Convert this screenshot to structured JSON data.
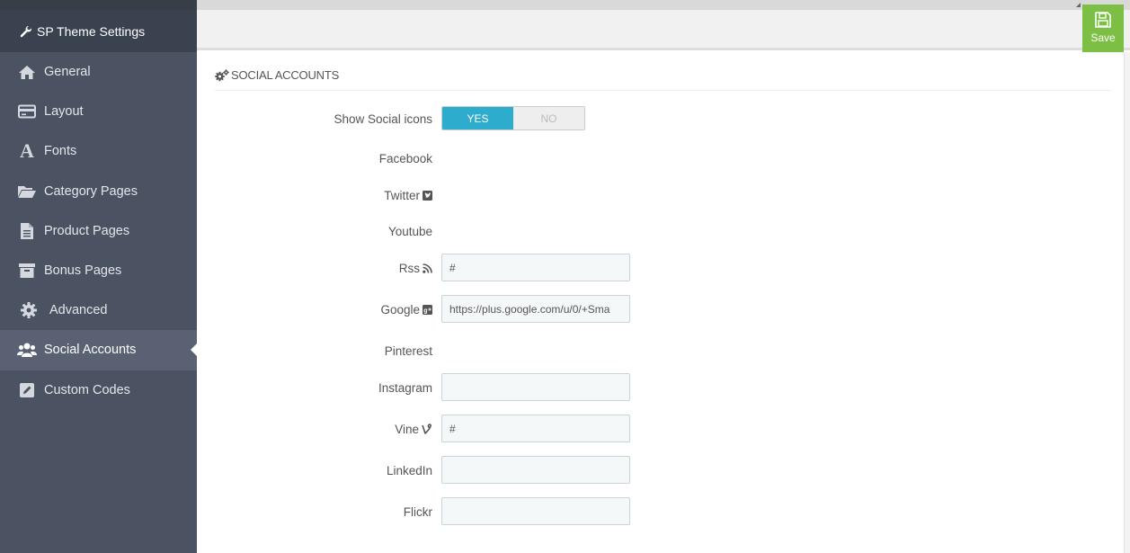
{
  "sidebar": {
    "title": "SP Theme Settings",
    "items": [
      {
        "label": "General",
        "icon": "home-icon"
      },
      {
        "label": "Layout",
        "icon": "credit-card-icon"
      },
      {
        "label": "Fonts",
        "icon": "font-icon"
      },
      {
        "label": "Category Pages",
        "icon": "folder-open-icon"
      },
      {
        "label": "Product Pages",
        "icon": "file-text-icon"
      },
      {
        "label": "Bonus Pages",
        "icon": "archive-icon"
      },
      {
        "label": "Advanced",
        "icon": "gear-icon"
      },
      {
        "label": "Social Accounts",
        "icon": "users-icon",
        "active": true
      },
      {
        "label": "Custom Codes",
        "icon": "edit-icon"
      }
    ]
  },
  "toolbar": {
    "save_label": "Save"
  },
  "panel": {
    "title": "SOCIAL ACCOUNTS",
    "show_social_icons": {
      "label": "Show Social icons",
      "yes_label": "YES",
      "no_label": "NO",
      "value": "YES"
    },
    "fields": {
      "facebook": {
        "label": "Facebook"
      },
      "twitter": {
        "label": "Twitter"
      },
      "youtube": {
        "label": "Youtube"
      },
      "rss": {
        "label": "Rss",
        "value": "#"
      },
      "google": {
        "label": "Google",
        "value": "https://plus.google.com/u/0/+Sma"
      },
      "pinterest": {
        "label": "Pinterest"
      },
      "instagram": {
        "label": "Instagram",
        "value": ""
      },
      "vine": {
        "label": "Vine",
        "value": "#"
      },
      "linkedin": {
        "label": "LinkedIn",
        "value": ""
      },
      "flickr": {
        "label": "Flickr",
        "value": ""
      }
    }
  },
  "colors": {
    "sidebar_bg": "#4b5262",
    "sidebar_active": "#596172",
    "toggle_yes": "#2eacce",
    "save_button": "#7dbf45"
  }
}
